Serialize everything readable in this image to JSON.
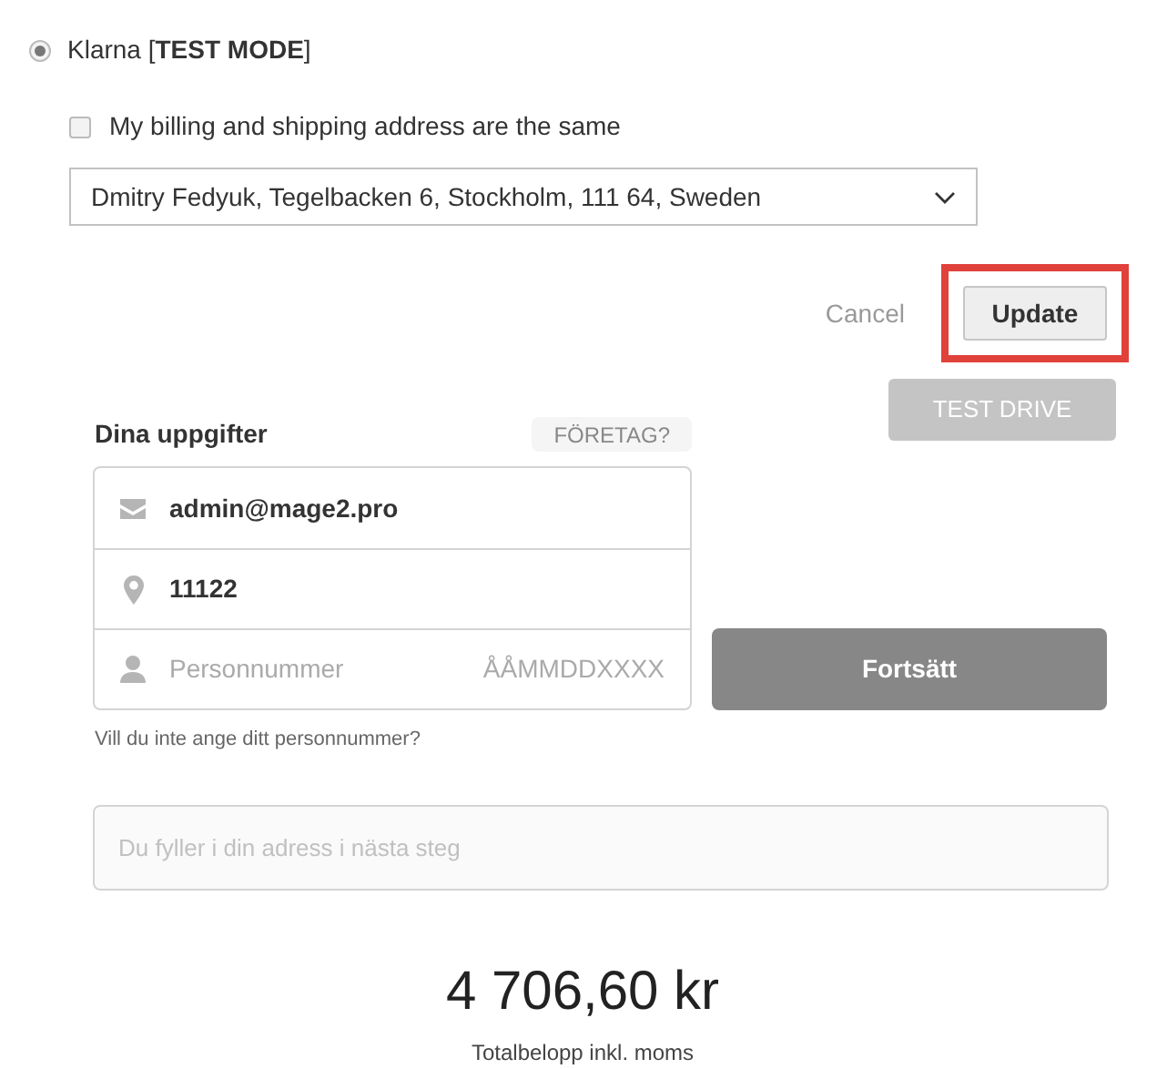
{
  "payment_method": {
    "label": "Klarna [**TEST MODE**]",
    "selected": true
  },
  "same_address": {
    "label": "My billing and shipping address are the same",
    "checked": false
  },
  "address_select": {
    "value": "Dmitry Fedyuk, Tegelbacken 6, Stockholm, 111 64, Sweden"
  },
  "actions": [
    {
      "kind": "link",
      "label": "Cancel"
    },
    {
      "kind": "button",
      "label": "Update",
      "highlighted": true
    }
  ],
  "test_drive": {
    "label": "TEST DRIVE"
  },
  "klarna": {
    "title": "Dina uppgifter",
    "company_toggle": "FÖRETAG?",
    "fields": [
      {
        "kind": "email",
        "value": "admin@mage2.pro"
      },
      {
        "kind": "location",
        "value": "11122"
      },
      {
        "kind": "person",
        "placeholder": "Personnummer",
        "hint": "ÅÅMMDDXXXX"
      }
    ],
    "continue": "Fortsätt",
    "no_id_link": "Vill du inte ange ditt personnummer?",
    "address_field": {
      "placeholder": "Du fyller i din adress i nästa steg"
    },
    "total": "4 706,60 kr",
    "total_label": "Totalbelopp inkl. moms"
  }
}
